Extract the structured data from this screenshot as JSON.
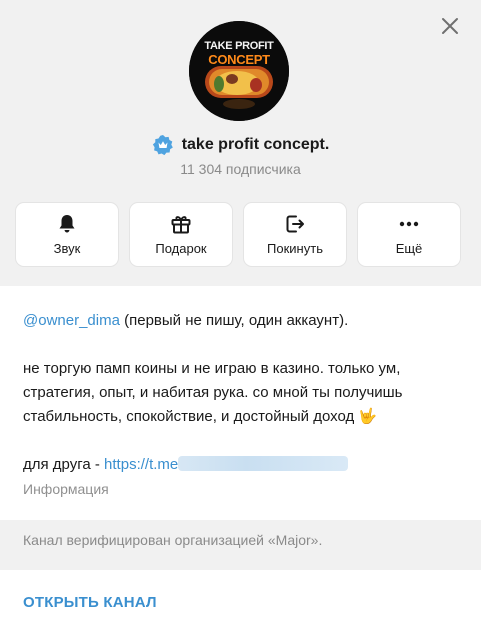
{
  "window": {
    "close_icon": "close-icon"
  },
  "channel": {
    "avatar_line1": "TAKE PROFIT",
    "avatar_line2": "CONCEPT",
    "name": "take profit concept.",
    "subscribers": "11 304 подписчика",
    "verified_icon": "verified-badge-icon",
    "accent_color": "#3a8fcf",
    "verified_color": "#4fa3e0"
  },
  "actions": [
    {
      "label": "Звук",
      "icon": "bell-icon"
    },
    {
      "label": "Подарок",
      "icon": "gift-icon"
    },
    {
      "label": "Покинуть",
      "icon": "leave-icon"
    },
    {
      "label": "Ещё",
      "icon": "more-icon"
    }
  ],
  "about": {
    "mention": "@owner_dima",
    "mention_rest": " (первый не пишу, один аккаунт).",
    "description": "не торгую памп коины и не играю в казино. только ум, стратегия, опыт, и набитая рука. со мной ты получишь стабильность, спокойствие, и достойный доход",
    "emoji": "🤟",
    "friend_prefix": "для друга - ",
    "friend_link": "https://t.me",
    "info_label": "Информация"
  },
  "verification_note": "Канал верифицирован организацией «Major».",
  "open_channel_label": "ОТКРЫТЬ КАНАЛ"
}
